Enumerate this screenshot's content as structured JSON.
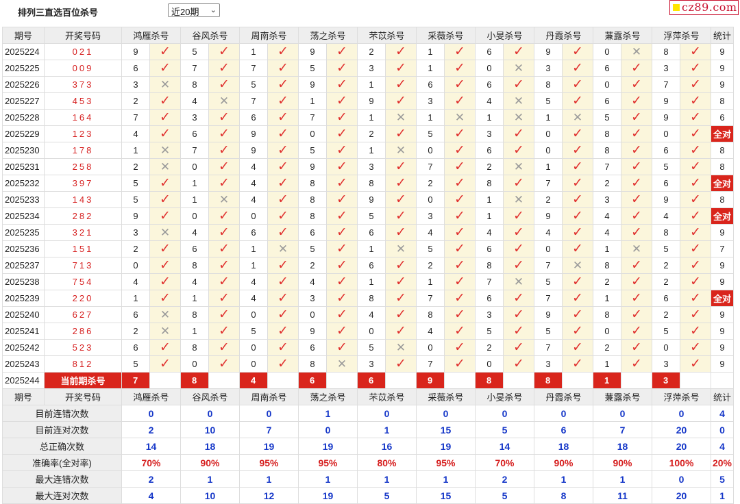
{
  "header": {
    "title": "排列三直选百位杀号",
    "period_select": "近20期",
    "brand": "cz89.com"
  },
  "columns": {
    "issue": "期号",
    "draw": "开奖号码",
    "experts": [
      "鸿雁杀号",
      "谷风杀号",
      "周南杀号",
      "荡之杀号",
      "芣苡杀号",
      "采薇杀号",
      "小旻杀号",
      "丹霞杀号",
      "蒹露杀号",
      "浮萍杀号"
    ],
    "count": "统计"
  },
  "marks": {
    "ok": "✓",
    "bad": "✕"
  },
  "rows": [
    {
      "issue": "2025224",
      "draw": "021",
      "kills": [
        9,
        5,
        1,
        9,
        2,
        1,
        6,
        9,
        0,
        8
      ],
      "hits": [
        1,
        1,
        1,
        1,
        1,
        1,
        1,
        1,
        0,
        1
      ],
      "count": "9"
    },
    {
      "issue": "2025225",
      "draw": "009",
      "kills": [
        6,
        7,
        7,
        5,
        3,
        1,
        0,
        3,
        6,
        3
      ],
      "hits": [
        1,
        1,
        1,
        1,
        1,
        1,
        0,
        1,
        1,
        1
      ],
      "count": "9"
    },
    {
      "issue": "2025226",
      "draw": "373",
      "kills": [
        3,
        8,
        5,
        9,
        1,
        6,
        6,
        8,
        0,
        7
      ],
      "hits": [
        0,
        1,
        1,
        1,
        1,
        1,
        1,
        1,
        1,
        1
      ],
      "count": "9"
    },
    {
      "issue": "2025227",
      "draw": "453",
      "kills": [
        2,
        4,
        7,
        1,
        9,
        3,
        4,
        5,
        6,
        9
      ],
      "hits": [
        1,
        0,
        1,
        1,
        1,
        1,
        0,
        1,
        1,
        1
      ],
      "count": "8"
    },
    {
      "issue": "2025228",
      "draw": "164",
      "kills": [
        7,
        3,
        6,
        7,
        1,
        1,
        1,
        1,
        5,
        9
      ],
      "hits": [
        1,
        1,
        1,
        1,
        0,
        0,
        0,
        0,
        1,
        1
      ],
      "count": "6"
    },
    {
      "issue": "2025229",
      "draw": "123",
      "kills": [
        4,
        6,
        9,
        0,
        2,
        5,
        3,
        0,
        8,
        0
      ],
      "hits": [
        1,
        1,
        1,
        1,
        1,
        1,
        1,
        1,
        1,
        1
      ],
      "count": "全对"
    },
    {
      "issue": "2025230",
      "draw": "178",
      "kills": [
        1,
        7,
        9,
        5,
        1,
        0,
        6,
        0,
        8,
        6
      ],
      "hits": [
        0,
        1,
        1,
        1,
        0,
        1,
        1,
        1,
        1,
        1
      ],
      "count": "8"
    },
    {
      "issue": "2025231",
      "draw": "258",
      "kills": [
        2,
        0,
        4,
        9,
        3,
        7,
        2,
        1,
        7,
        5
      ],
      "hits": [
        0,
        1,
        1,
        1,
        1,
        1,
        0,
        1,
        1,
        1
      ],
      "count": "8"
    },
    {
      "issue": "2025232",
      "draw": "397",
      "kills": [
        5,
        1,
        4,
        8,
        8,
        2,
        8,
        7,
        2,
        6
      ],
      "hits": [
        1,
        1,
        1,
        1,
        1,
        1,
        1,
        1,
        1,
        1
      ],
      "count": "全对"
    },
    {
      "issue": "2025233",
      "draw": "143",
      "kills": [
        5,
        1,
        4,
        8,
        9,
        0,
        1,
        2,
        3,
        9
      ],
      "hits": [
        1,
        0,
        1,
        1,
        1,
        1,
        0,
        1,
        1,
        1
      ],
      "count": "8"
    },
    {
      "issue": "2025234",
      "draw": "282",
      "kills": [
        9,
        0,
        0,
        8,
        5,
        3,
        1,
        9,
        4,
        4
      ],
      "hits": [
        1,
        1,
        1,
        1,
        1,
        1,
        1,
        1,
        1,
        1
      ],
      "count": "全对"
    },
    {
      "issue": "2025235",
      "draw": "321",
      "kills": [
        3,
        4,
        6,
        6,
        6,
        4,
        4,
        4,
        4,
        8
      ],
      "hits": [
        0,
        1,
        1,
        1,
        1,
        1,
        1,
        1,
        1,
        1
      ],
      "count": "9"
    },
    {
      "issue": "2025236",
      "draw": "151",
      "kills": [
        2,
        6,
        1,
        5,
        1,
        5,
        6,
        0,
        1,
        5
      ],
      "hits": [
        1,
        1,
        0,
        1,
        0,
        1,
        1,
        1,
        0,
        1
      ],
      "count": "7"
    },
    {
      "issue": "2025237",
      "draw": "713",
      "kills": [
        0,
        8,
        1,
        2,
        6,
        2,
        8,
        7,
        8,
        2
      ],
      "hits": [
        1,
        1,
        1,
        1,
        1,
        1,
        1,
        0,
        1,
        1
      ],
      "count": "9"
    },
    {
      "issue": "2025238",
      "draw": "754",
      "kills": [
        4,
        4,
        4,
        4,
        1,
        1,
        7,
        5,
        2,
        2
      ],
      "hits": [
        1,
        1,
        1,
        1,
        1,
        1,
        0,
        1,
        1,
        1
      ],
      "count": "9"
    },
    {
      "issue": "2025239",
      "draw": "220",
      "kills": [
        1,
        1,
        4,
        3,
        8,
        7,
        6,
        7,
        1,
        6
      ],
      "hits": [
        1,
        1,
        1,
        1,
        1,
        1,
        1,
        1,
        1,
        1
      ],
      "count": "全对"
    },
    {
      "issue": "2025240",
      "draw": "627",
      "kills": [
        6,
        8,
        0,
        0,
        4,
        8,
        3,
        9,
        8,
        2
      ],
      "hits": [
        0,
        1,
        1,
        1,
        1,
        1,
        1,
        1,
        1,
        1
      ],
      "count": "9"
    },
    {
      "issue": "2025241",
      "draw": "286",
      "kills": [
        2,
        1,
        5,
        9,
        0,
        4,
        5,
        5,
        0,
        5
      ],
      "hits": [
        0,
        1,
        1,
        1,
        1,
        1,
        1,
        1,
        1,
        1
      ],
      "count": "9"
    },
    {
      "issue": "2025242",
      "draw": "523",
      "kills": [
        6,
        8,
        0,
        6,
        5,
        0,
        2,
        7,
        2,
        0
      ],
      "hits": [
        1,
        1,
        1,
        1,
        0,
        1,
        1,
        1,
        1,
        1
      ],
      "count": "9"
    },
    {
      "issue": "2025243",
      "draw": "812",
      "kills": [
        5,
        0,
        0,
        8,
        3,
        7,
        0,
        3,
        1,
        3
      ],
      "hits": [
        1,
        1,
        1,
        0,
        1,
        1,
        1,
        1,
        1,
        1
      ],
      "count": "9"
    }
  ],
  "current": {
    "issue": "2025244",
    "label": "当前期杀号",
    "kills": [
      "7",
      "8",
      "4",
      "6",
      "6",
      "9",
      "8",
      "8",
      "1",
      "3"
    ]
  },
  "stats": [
    {
      "label": "目前连错次数",
      "values": [
        "0",
        "0",
        "0",
        "1",
        "0",
        "0",
        "0",
        "0",
        "0",
        "0"
      ],
      "count": "4"
    },
    {
      "label": "目前连对次数",
      "values": [
        "2",
        "10",
        "7",
        "0",
        "1",
        "15",
        "5",
        "6",
        "7",
        "20"
      ],
      "count": "0"
    },
    {
      "label": "总正确次数",
      "values": [
        "14",
        "18",
        "19",
        "19",
        "16",
        "19",
        "14",
        "18",
        "18",
        "20"
      ],
      "count": "4"
    },
    {
      "label": "准确率(全对率)",
      "values": [
        "70%",
        "90%",
        "95%",
        "95%",
        "80%",
        "95%",
        "70%",
        "90%",
        "90%",
        "100%"
      ],
      "count": "20%"
    },
    {
      "label": "最大连错次数",
      "values": [
        "2",
        "1",
        "1",
        "1",
        "1",
        "1",
        "2",
        "1",
        "1",
        "0"
      ],
      "count": "5"
    },
    {
      "label": "最大连对次数",
      "values": [
        "4",
        "10",
        "12",
        "19",
        "5",
        "15",
        "5",
        "8",
        "11",
        "20"
      ],
      "count": "1"
    }
  ],
  "colors": {
    "accent_red": "#d9251c",
    "draw_red": "#d61f1f",
    "stat_blue": "#1436c8",
    "result_bg": "#fbf6dc",
    "header_bg": "#eeeeee"
  }
}
